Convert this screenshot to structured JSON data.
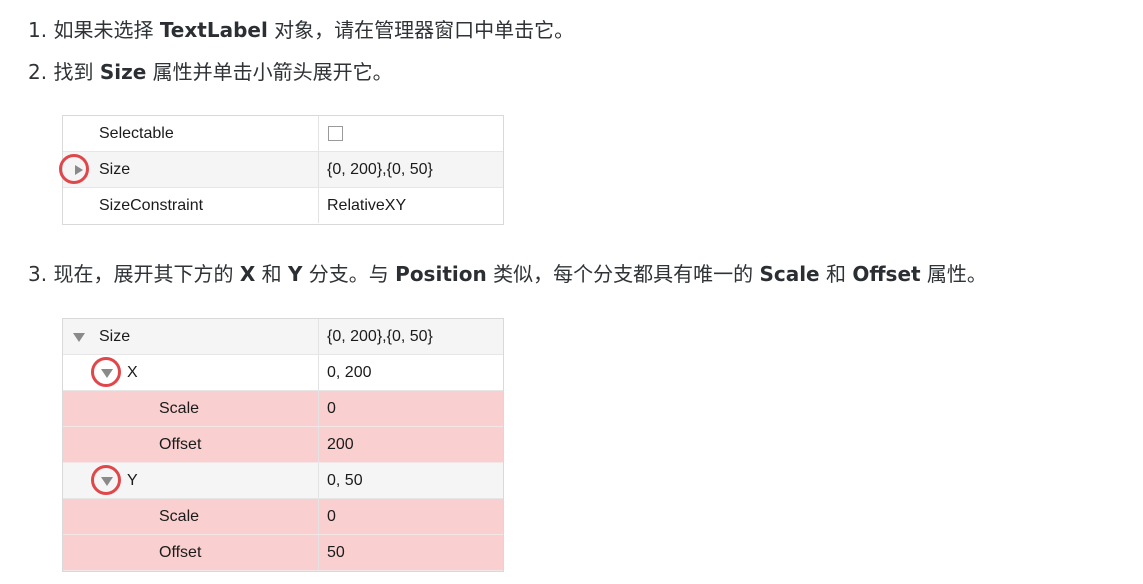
{
  "steps": {
    "s1": {
      "num": "1.",
      "pre": "如果未选择 ",
      "bold": "TextLabel",
      "post": " 对象，请在管理器窗口中单击它。"
    },
    "s2": {
      "num": "2.",
      "pre": "找到 ",
      "bold": "Size",
      "post": " 属性并单击小箭头展开它。"
    },
    "s3": {
      "num": "3.",
      "pre": "现在，展开其下方的 ",
      "b1": "X",
      "mid1": " 和 ",
      "b2": "Y",
      "mid2": " 分支。与 ",
      "b3": "Position",
      "mid3": " 类似，每个分支都具有唯一的 ",
      "b4": "Scale",
      "mid4": " 和 ",
      "b5": "Offset",
      "post": " 属性。"
    }
  },
  "panel1": {
    "rows": [
      {
        "name": "Selectable",
        "value": ""
      },
      {
        "name": "Size",
        "value": "{0, 200},{0, 50}"
      },
      {
        "name": "SizeConstraint",
        "value": "RelativeXY"
      }
    ]
  },
  "panel2": {
    "rows": [
      {
        "name": "Size",
        "value": "{0, 200},{0, 50}"
      },
      {
        "name": "X",
        "value": "0, 200"
      },
      {
        "name": "Scale",
        "value": "0"
      },
      {
        "name": "Offset",
        "value": "200"
      },
      {
        "name": "Y",
        "value": "0, 50"
      },
      {
        "name": "Scale",
        "value": "0"
      },
      {
        "name": "Offset",
        "value": "50"
      }
    ]
  },
  "colors": {
    "highlight_row": "#f9cfcf",
    "ring": "#e0474a",
    "arrow": "#8a8a8a"
  },
  "icons": {
    "collapsed": "triangle-right-icon",
    "expanded": "triangle-down-icon",
    "checkbox": "checkbox-unchecked"
  }
}
